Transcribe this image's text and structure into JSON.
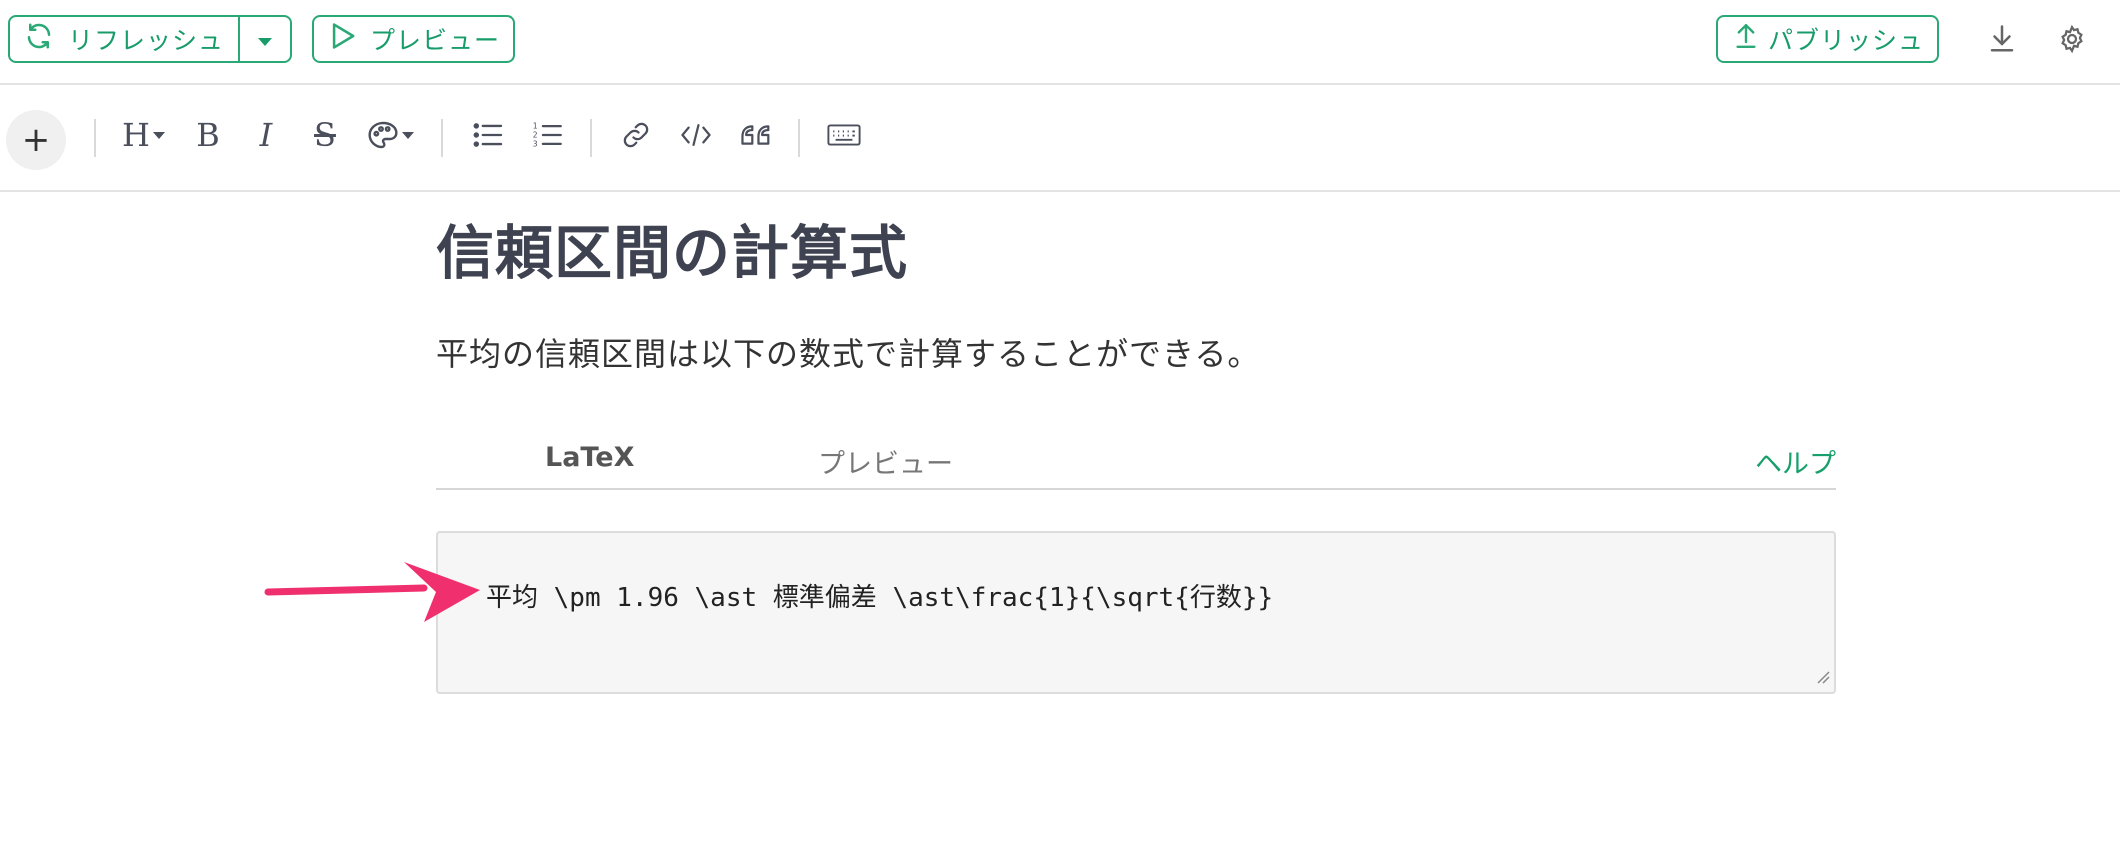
{
  "topbar": {
    "refresh_label": "リフレッシュ",
    "preview_label": "プレビュー",
    "publish_label": "パブリッシュ",
    "refresh_icon": "refresh-icon",
    "dropdown_icon": "caret-down-icon",
    "preview_icon": "play-icon",
    "publish_icon": "upload-icon",
    "download_icon": "download-icon",
    "settings_icon": "gear-icon"
  },
  "toolbar": {
    "add": "+",
    "heading": "H",
    "bold": "B",
    "italic": "I",
    "strike": "S",
    "items": [
      "heading-icon",
      "bold-icon",
      "italic-icon",
      "strikethrough-icon",
      "palette-icon",
      "bullet-list-icon",
      "numbered-list-icon",
      "link-icon",
      "code-icon",
      "quote-icon",
      "keyboard-icon"
    ]
  },
  "document": {
    "title": "信頼区間の計算式",
    "paragraph": "平均の信頼区間は以下の数式で計算することができる。"
  },
  "math_block": {
    "tab_latex": "LaTeX",
    "tab_preview": "プレビュー",
    "help": "ヘルプ",
    "code": "平均 \\pm 1.96 \\ast 標準偏差 \\ast\\frac{1}{\\sqrt{行数}}"
  },
  "colors": {
    "accent": "#2aa876",
    "title": "#3f4351",
    "arrow": "#f0306e",
    "editor_bg": "#f6f6f6"
  }
}
